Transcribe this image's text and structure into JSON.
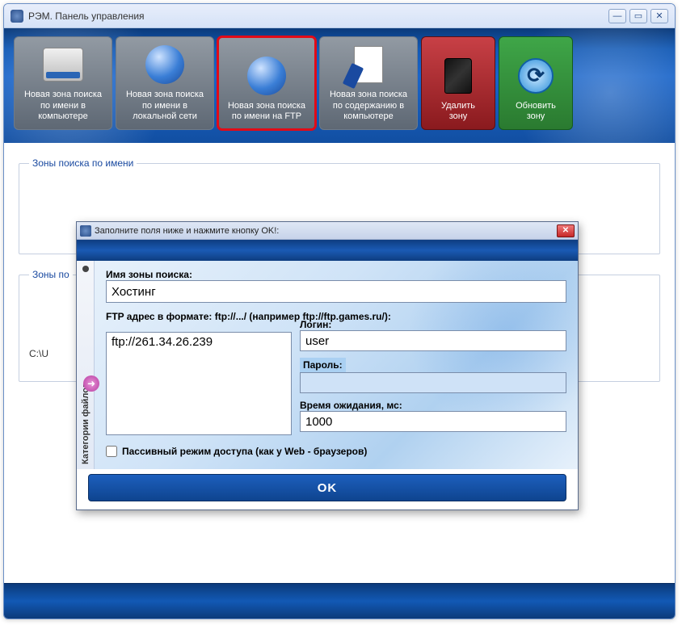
{
  "window": {
    "title": "РЭМ. Панель управления",
    "buttons": {
      "min": "—",
      "max": "▭",
      "close": "✕"
    }
  },
  "toolbar": [
    {
      "id": "new-zone-computer",
      "label": "Новая зона поиска\nпо имени в\nкомпьютере",
      "icon": "hdd"
    },
    {
      "id": "new-zone-lan",
      "label": "Новая зона поиска\nпо имени в\nлокальной сети",
      "icon": "globe"
    },
    {
      "id": "new-zone-ftp",
      "label": "Новая зона поиска\nпо имени на FTP",
      "icon": "globe",
      "active": true
    },
    {
      "id": "new-zone-content",
      "label": "Новая зона поиска\nпо содержанию в\nкомпьютере",
      "icon": "doc"
    },
    {
      "id": "delete-zone",
      "label": "Удалить\nзону",
      "icon": "trash",
      "variant": "red"
    },
    {
      "id": "refresh-zone",
      "label": "Обновить\nзону",
      "icon": "refresh",
      "variant": "green"
    }
  ],
  "groups": {
    "byName": "Зоны поиска по имени",
    "byContent": "Зоны по",
    "path": "C:\\U"
  },
  "dialog": {
    "title": "Заполните поля ниже и нажмите кнопку OK!:",
    "sidebar_label": "Категории файлов",
    "labels": {
      "zone_name": "Имя зоны поиска:",
      "ftp_format": "FTP адрес в формате: ftp://.../ (например ftp://ftp.games.ru/):",
      "login": "Логин:",
      "password": "Пароль:",
      "timeout": "Время ожидания, мс:",
      "passive": "Пассивный режим доступа (как у Web - браузеров)"
    },
    "values": {
      "zone_name": "Хостинг",
      "ftp": "ftp://261.34.26.239",
      "login": "user",
      "password": "",
      "timeout": "1000",
      "passive": false
    },
    "ok": "OK"
  }
}
